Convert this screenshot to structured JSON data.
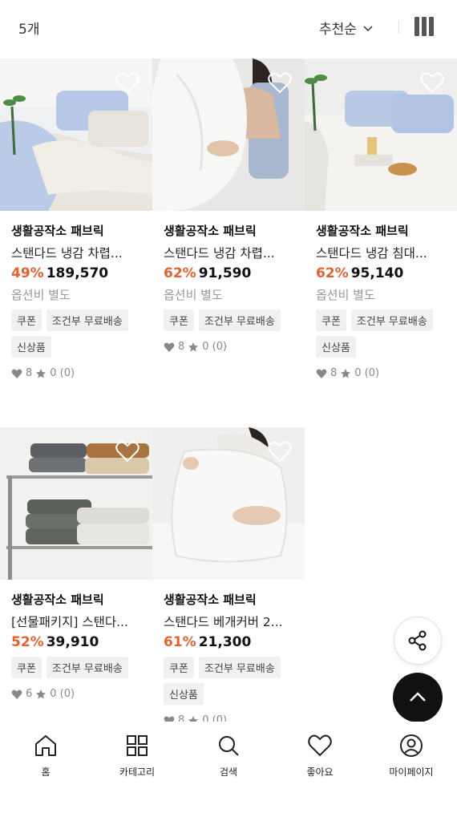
{
  "header": {
    "count": "5개",
    "sort_label": "추천순"
  },
  "products": [
    {
      "brand": "생활공작소 패브릭",
      "name": "스탠다드 냉감 차렵...",
      "discount": "49%",
      "price": "189,570",
      "option": "옵션비 별도",
      "tags": [
        "쿠폰",
        "조건부 무료배송",
        "신상품"
      ],
      "likes": "8",
      "rating": "0 (0)"
    },
    {
      "brand": "생활공작소 패브릭",
      "name": "스탠다드 냉감 차렵...",
      "discount": "62%",
      "price": "91,590",
      "option": "옵션비 별도",
      "tags": [
        "쿠폰",
        "조건부 무료배송"
      ],
      "likes": "8",
      "rating": "0 (0)"
    },
    {
      "brand": "생활공작소 패브릭",
      "name": "스탠다드 냉감 침대...",
      "discount": "62%",
      "price": "95,140",
      "option": "옵션비 별도",
      "tags": [
        "쿠폰",
        "조건부 무료배송",
        "신상품"
      ],
      "likes": "8",
      "rating": "0 (0)"
    },
    {
      "brand": "생활공작소 패브릭",
      "name": "[선물패키지] 스탠다...",
      "discount": "52%",
      "price": "39,910",
      "option": "",
      "tags": [
        "쿠폰",
        "조건부 무료배송"
      ],
      "likes": "6",
      "rating": "0 (0)"
    },
    {
      "brand": "생활공작소 패브릭",
      "name": "스탠다드 베개커버 2...",
      "discount": "61%",
      "price": "21,300",
      "option": "",
      "tags": [
        "쿠폰",
        "조건부 무료배송",
        "신상품"
      ],
      "likes": "8",
      "rating": "0 (0)"
    }
  ],
  "nav": {
    "home": "홈",
    "category": "카테고리",
    "search": "검색",
    "likes": "좋아요",
    "mypage": "마이페이지"
  },
  "colors": {
    "discount": "#e0622e",
    "tag_bg": "#f1f1f1"
  }
}
